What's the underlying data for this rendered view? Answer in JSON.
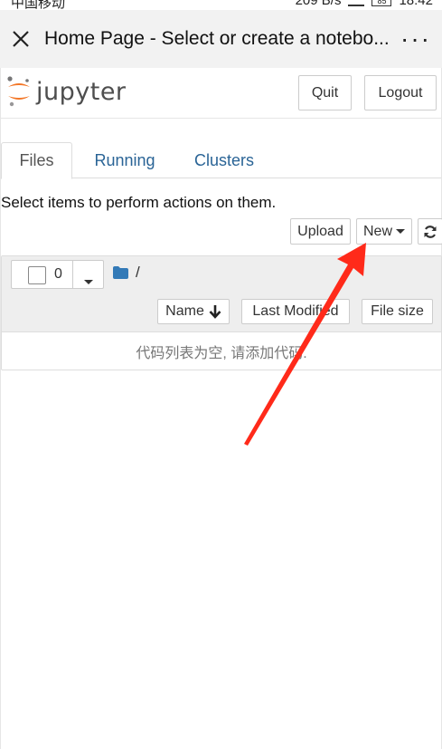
{
  "statusbar": {
    "carrier": "中国移动",
    "net_speed": "209 B/s",
    "battery": "85",
    "time": "18:42"
  },
  "titlebar": {
    "title": "Home Page - Select or create a notebo...",
    "close_icon": "close-icon",
    "more": "···"
  },
  "header": {
    "logo_text": "jupyter",
    "quit": "Quit",
    "logout": "Logout"
  },
  "tabs": [
    {
      "label": "Files",
      "active": true
    },
    {
      "label": "Running",
      "active": false
    },
    {
      "label": "Clusters",
      "active": false
    }
  ],
  "toolbar": {
    "info": "Select items to perform actions on them.",
    "upload": "Upload",
    "new": "New",
    "refresh_icon": "refresh-icon"
  },
  "filelist": {
    "selected_count": "0",
    "breadcrumb": "/",
    "columns": {
      "name": "Name",
      "modified": "Last Modified",
      "size": "File size"
    },
    "empty_message": "代码列表为空, 请添加代码."
  },
  "colors": {
    "link": "#2a6496",
    "logo_orange": "#f37626",
    "folder": "#337ab7",
    "annotation": "#ff2a1a"
  }
}
